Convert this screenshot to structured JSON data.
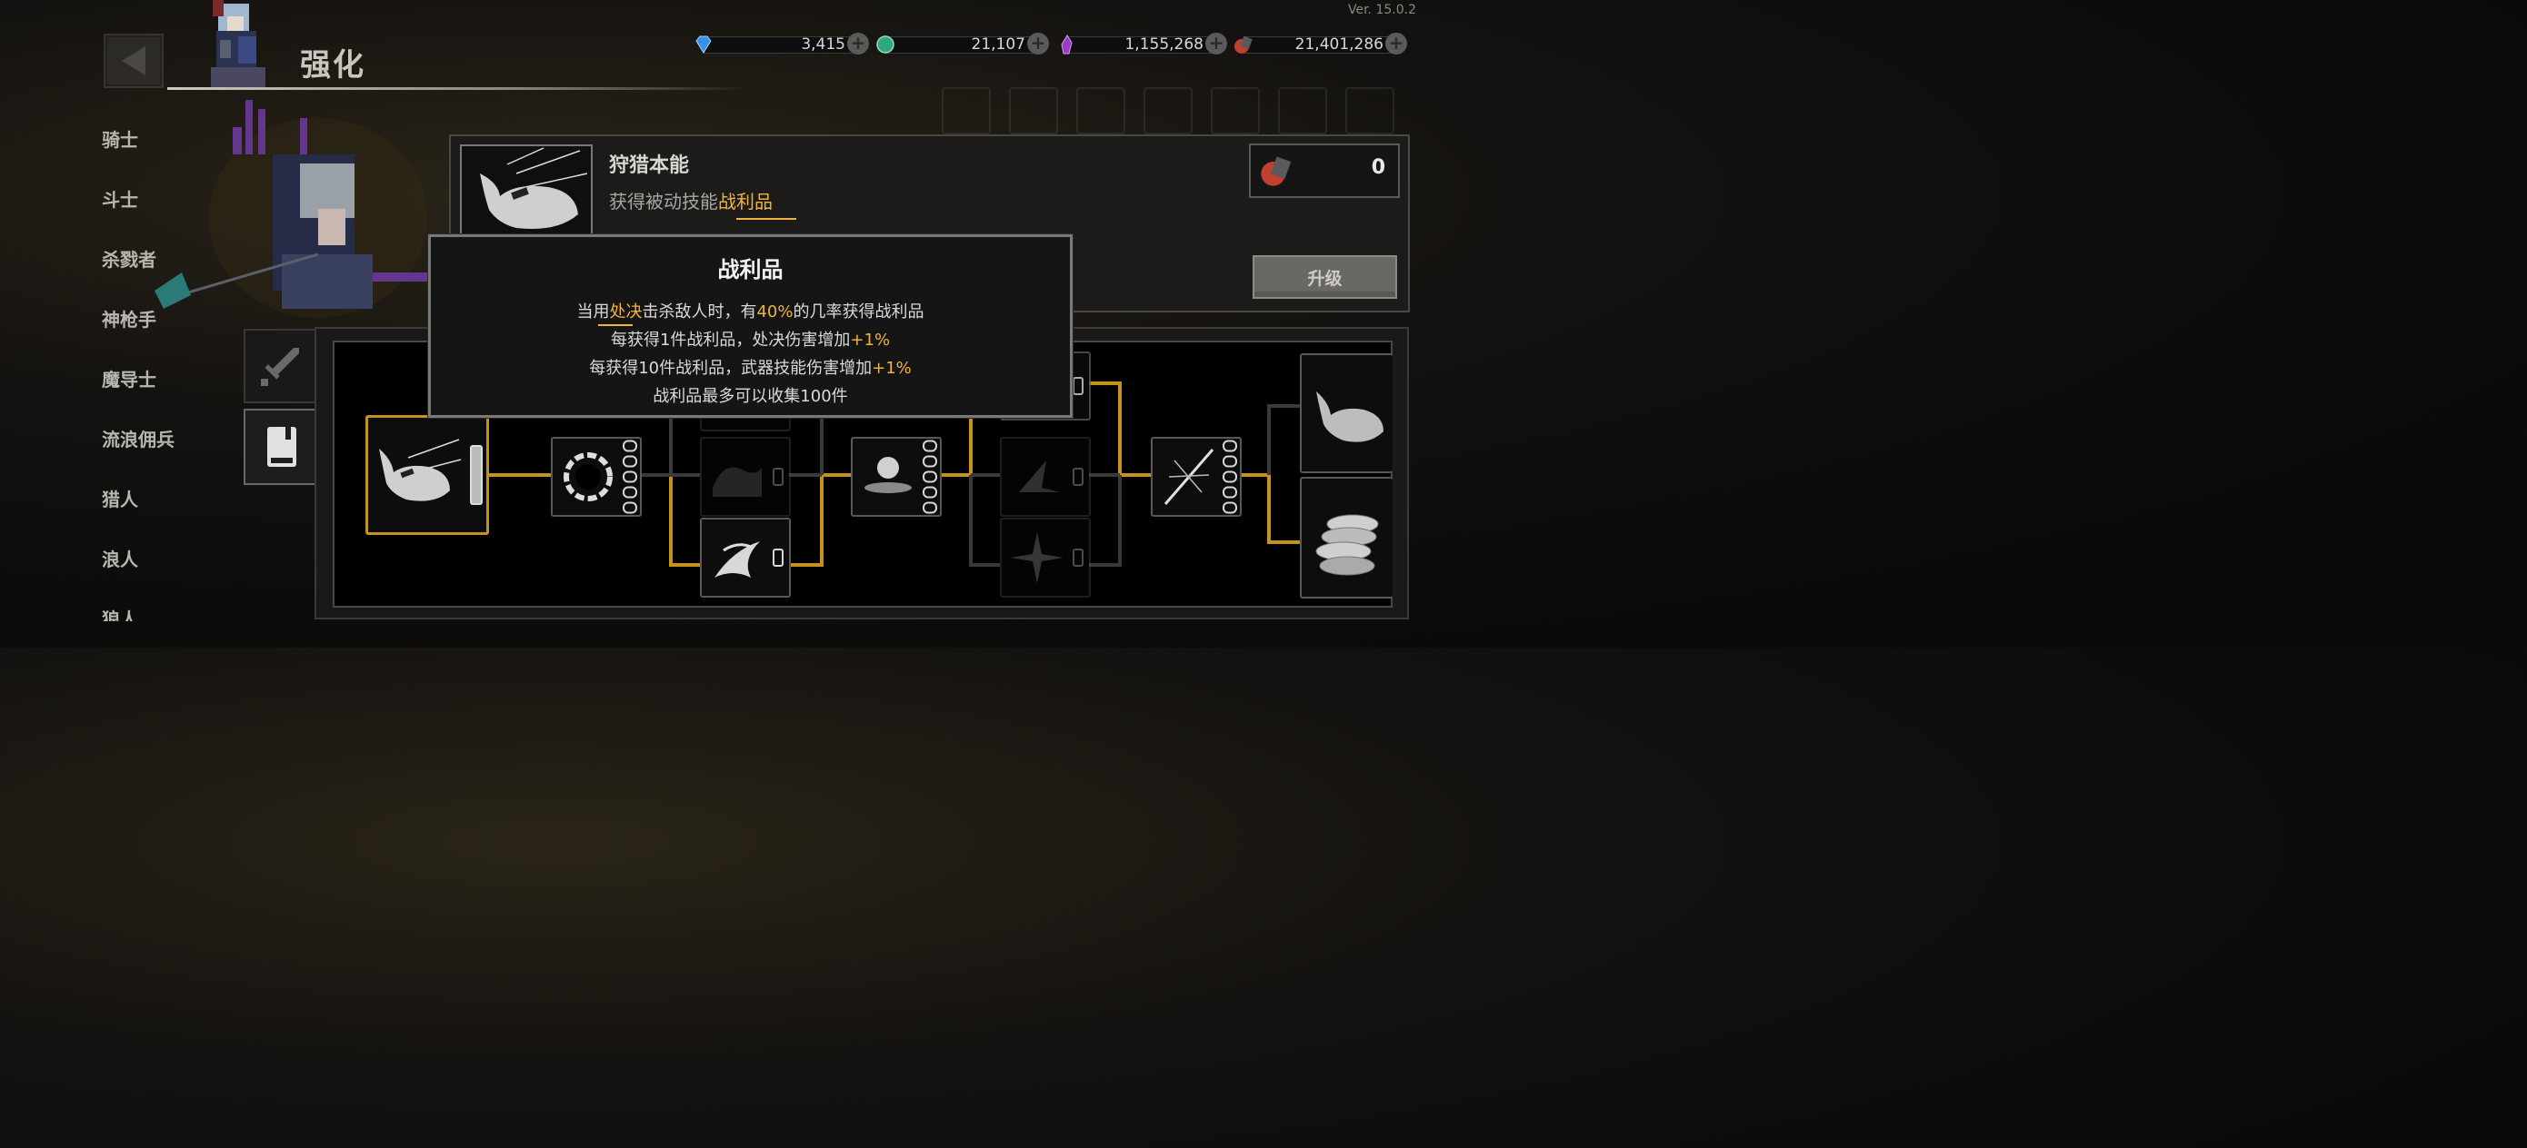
{
  "version": "Ver. 15.0.2",
  "header": {
    "title": "强化"
  },
  "currencies": [
    {
      "name": "diamond",
      "icon": "diamond-icon",
      "value": "3,415",
      "color": "#3a8fe8"
    },
    {
      "name": "emerald",
      "icon": "green-gem-icon",
      "value": "21,107",
      "color": "#2fa882"
    },
    {
      "name": "crystal",
      "icon": "purple-crystal-icon",
      "value": "1,155,268",
      "color": "#9b3bc9"
    },
    {
      "name": "ore",
      "icon": "red-ore-icon",
      "value": "21,401,286",
      "color": "#c04030"
    }
  ],
  "sidebar": {
    "items": [
      {
        "label": "骑士"
      },
      {
        "label": "斗士"
      },
      {
        "label": "杀戮者"
      },
      {
        "label": "神枪手"
      },
      {
        "label": "魔导士"
      },
      {
        "label": "流浪佣兵"
      },
      {
        "label": "猎人"
      },
      {
        "label": "浪人"
      },
      {
        "label": "狼人"
      }
    ]
  },
  "skill": {
    "name": "狩猎本能",
    "desc_prefix": "获得被动技能",
    "desc_highlight": "战利品",
    "cost": "0",
    "upgrade_label": "升级",
    "icon": "shark-icon"
  },
  "tooltip": {
    "title": "战利品",
    "line1": {
      "a": "当用",
      "b": "处决",
      "c": "击杀敌人时，有",
      "d": "40%",
      "e": "的几率获得战利品"
    },
    "line2": {
      "a": "每获得1件战利品，处决伤害增加",
      "b": "+1%"
    },
    "line3": {
      "a": "每获得10件战利品，武器技能伤害增加",
      "b": "+1%"
    },
    "line4": "战利品最多可以收集100件"
  },
  "tabs": [
    {
      "name": "weapon",
      "icon": "sword-icon"
    },
    {
      "name": "skill-book",
      "icon": "book-icon"
    }
  ],
  "colors": {
    "accent": "#f0b43a",
    "link_line": "#c7921c"
  }
}
